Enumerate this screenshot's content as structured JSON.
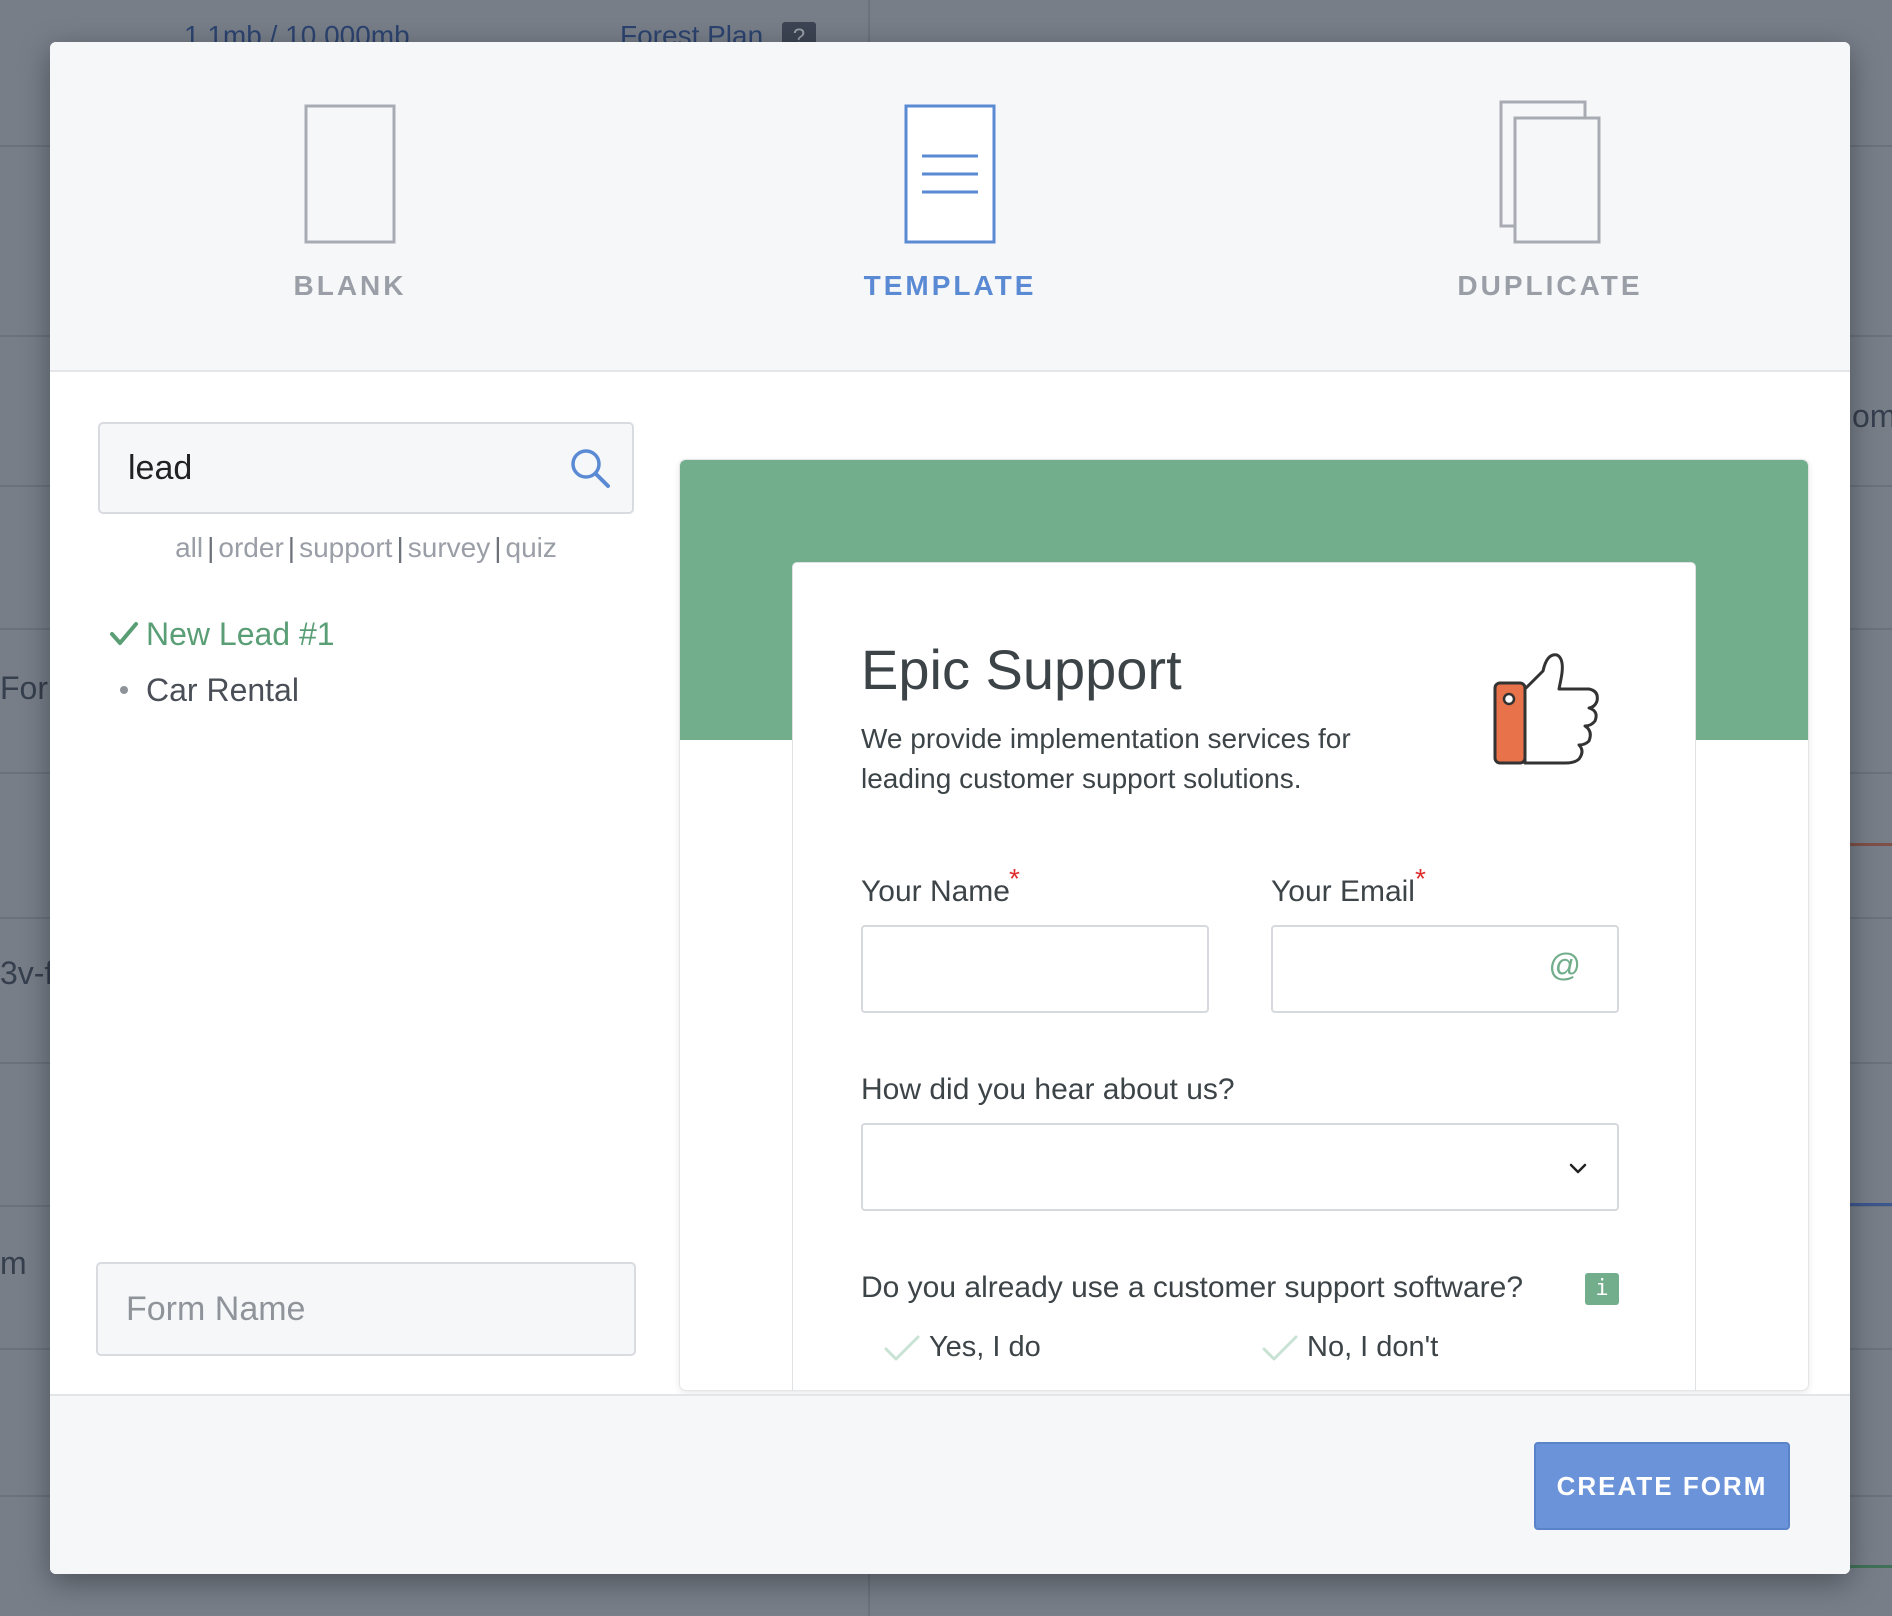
{
  "background": {
    "storage_usage": "1.1mb / 10,000mb",
    "plan": "Forest Plan",
    "plan_badge": "?",
    "fragments": [
      "For",
      "3v-f",
      "m",
      "om"
    ]
  },
  "form_types": [
    {
      "label": "BLANK",
      "icon": "blank-page-icon"
    },
    {
      "label": "TEMPLATE",
      "icon": "template-page-icon"
    },
    {
      "label": "DUPLICATE",
      "icon": "duplicate-pages-icon"
    }
  ],
  "selected_type": "TEMPLATE",
  "search": {
    "value": "lead",
    "icon": "search-icon"
  },
  "filters": [
    "all",
    "order",
    "support",
    "survey",
    "quiz"
  ],
  "filter_separator": "|",
  "templates": [
    {
      "name": "New Lead #1",
      "selected": true
    },
    {
      "name": "Car Rental",
      "selected": false
    }
  ],
  "form_name": {
    "placeholder": "Form Name",
    "value": ""
  },
  "preview": {
    "title": "Epic Support",
    "description": "We provide implementation services for leading customer support solutions.",
    "name_label": "Your Name",
    "email_label": "Your Email",
    "required_mark": "*",
    "email_icon": "@",
    "hear_label": "How did you hear about us?",
    "software_question": "Do you already use a customer support software?",
    "info_icon": "i",
    "choices": [
      "Yes, I do",
      "No, I don't"
    ]
  },
  "footer": {
    "create_label": "CREATE FORM"
  },
  "colors": {
    "accent_blue": "#6b93d9",
    "brand_green": "#72ae8b",
    "required_red": "#e02d2d",
    "thumb_orange": "#e8734a"
  }
}
